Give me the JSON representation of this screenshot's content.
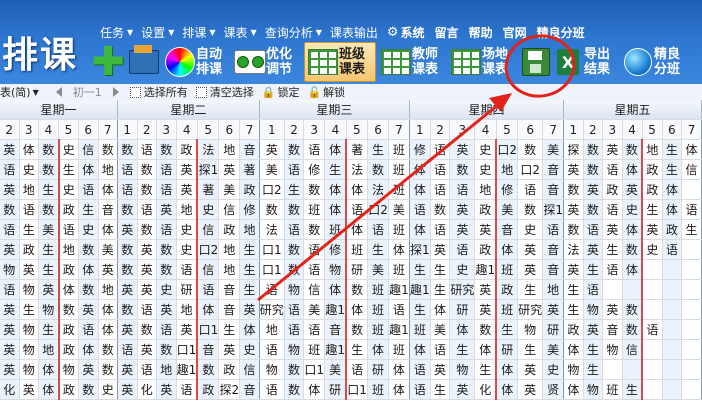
{
  "app": {
    "title": "排课"
  },
  "menu": [
    {
      "label": "任务",
      "arrow": "▼"
    },
    {
      "label": "设置",
      "arrow": "▼"
    },
    {
      "label": "排课",
      "arrow": "▼"
    },
    {
      "label": "课表",
      "arrow": "▼"
    },
    {
      "label": "查询分析",
      "arrow": "▼"
    },
    {
      "label": "课表输出",
      "arrow": ""
    }
  ],
  "menu_right": [
    "系统",
    "留言",
    "帮助",
    "官网",
    "精良分班"
  ],
  "toolbar": [
    {
      "id": "add",
      "label": "",
      "icon": "plus-icon"
    },
    {
      "id": "import",
      "label": "",
      "icon": "import-icon"
    },
    {
      "id": "auto",
      "label": "自动排课",
      "icon": "color-wheel-icon"
    },
    {
      "id": "optimize",
      "label": "优化调节",
      "icon": "toggle-pair-icon"
    },
    {
      "id": "class",
      "label": "班级课表",
      "icon": "grid-icon",
      "active": true
    },
    {
      "id": "teacher",
      "label": "教师课表",
      "icon": "grid-icon"
    },
    {
      "id": "venue",
      "label": "场地课表",
      "icon": "grid-icon"
    },
    {
      "id": "save",
      "label": "",
      "icon": "save-icon"
    },
    {
      "id": "excel",
      "label": "",
      "icon": "excel-icon"
    },
    {
      "id": "export",
      "label": "导出结果",
      "icon": ""
    },
    {
      "id": "split",
      "label": "精良分班",
      "icon": "globe-icon"
    }
  ],
  "subtoolbar": {
    "view_label": "表(简)",
    "class_label": "初一1",
    "select_all": "选择所有",
    "clear_select": "清空选择",
    "lock": "锁定",
    "unlock": "解锁"
  },
  "days": [
    "星期一",
    "星期二",
    "星期三",
    "星期四",
    "星期五"
  ],
  "periods_visible": [
    [
      "2",
      "3",
      "4",
      "5",
      "6",
      "7"
    ],
    [
      "1",
      "2",
      "3",
      "4",
      "5",
      "6",
      "7"
    ],
    [
      "1",
      "2",
      "3",
      "4",
      "5",
      "6",
      "7"
    ],
    [
      "1",
      "2",
      "3",
      "4",
      "5",
      "6",
      "7"
    ],
    [
      "1",
      "2",
      "3",
      "4",
      "5",
      "6",
      "7"
    ]
  ],
  "rows": [
    "英体数史信数数语数政法地音英数语体著生班修语英史口2数美探数英数地生体",
    "语史数生体地语数语英探1英著美语修生法数班体语数史地口2音英数语体政生信",
    "英地生史语体语数语英著美政口2生数体体法班体语语地修语音数英政英政体",
    "数语数政生音数语英地史信修数数班体语口2美语数英政美数探1英数语史生体语",
    "语生美语史体英数语史信政地法语数班体语班体语英英音史语数语英体英政生",
    "英政生地数美数英数史口2地生口1数语修班生体探1英语政体英音法英生数史语",
    "物英生政体英数英数语信地生口1数语物研美班生生史趣1班英音英生语体",
    "语物英体数地英英史研语音生语物信体数班趣1趣1生研究英政生地生语",
    "英生物数英体数语英地体音英研究语美趣1体班语生体研英班研究英生物英数",
    "英物生政语体英数语英口1生体地语语音数班趣1班美体数生物研政英音数语",
    "英物地政体数语英数口1音英史语物班趣1生体班体语生体研生美体生物信",
    "英物体物英数英语地趣1数政信物数口1美语研体语英物生体英史物生",
    "化英体政数史英化英语政探2音语数体研口1班体语生英化体英贤体物班生"
  ]
}
